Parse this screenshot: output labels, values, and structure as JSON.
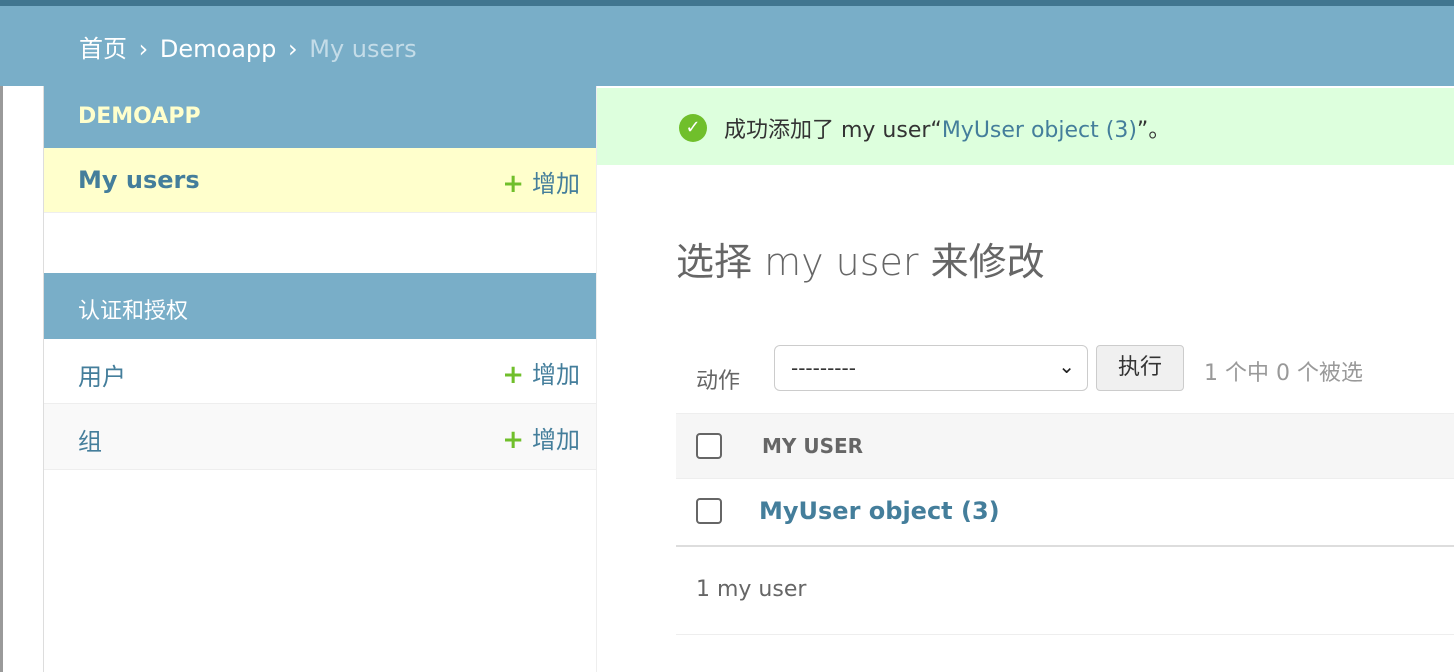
{
  "breadcrumbs": {
    "home": "首页",
    "app": "Demoapp",
    "current": "My users",
    "separator": "›"
  },
  "sidebar": {
    "apps": [
      {
        "caption": "DEMOAPP",
        "models": [
          {
            "label": "My users",
            "add_label": "增加"
          }
        ]
      },
      {
        "caption": "认证和授权",
        "models": [
          {
            "label": "用户",
            "add_label": "增加"
          },
          {
            "label": "组",
            "add_label": "增加"
          }
        ]
      }
    ],
    "add_icon": "+"
  },
  "message": {
    "icon": "✓",
    "prefix": "成功添加了 my user“",
    "link": "MyUser object (3)",
    "suffix": "”。"
  },
  "main": {
    "title": "选择 my user 来修改",
    "actions": {
      "label": "动作",
      "select_value": "---------",
      "go_label": "执行",
      "selected_count": "1 个中 0 个被选"
    },
    "table": {
      "header": "MY USER",
      "rows": [
        {
          "label": "MyUser object (3)"
        }
      ]
    },
    "paginator": "1 my user"
  },
  "colors": {
    "header_bg": "#79aec8",
    "top_strip": "#417690",
    "link": "#447e9b",
    "success_bg": "#dfd",
    "success_icon": "#70bf2b",
    "selected_row_bg": "#ffc",
    "add_plus": "#70bf2b"
  }
}
